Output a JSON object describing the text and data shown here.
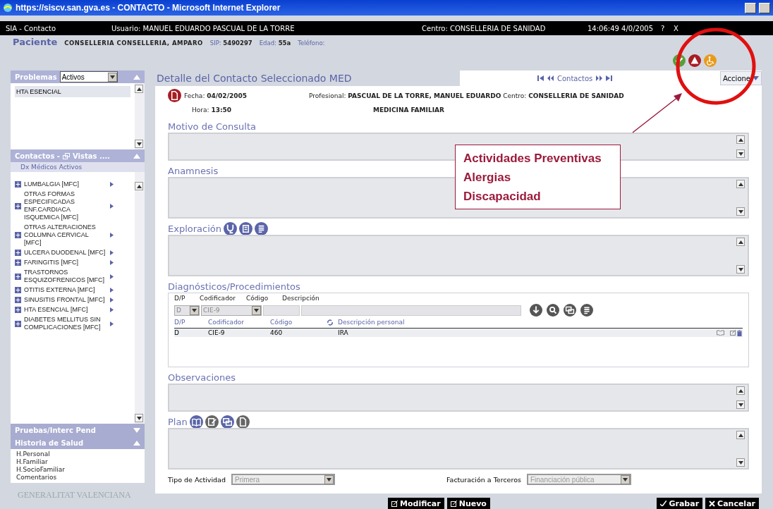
{
  "window": {
    "title": "https://siscv.san.gva.es - CONTACTO - Microsoft Internet Explorer"
  },
  "header": {
    "app": "SIA - Contacto",
    "user": "Usuario: MANUEL EDUARDO PASCUAL DE LA TORRE",
    "centro": "Centro: CONSELLERIA DE SANIDAD",
    "datetime": "14:06:49 4/0/2005",
    "help": "?",
    "close": "X"
  },
  "patient": {
    "label": "Paciente",
    "name": "CONSELLERIA CONSELLERIA, AMPARO",
    "sip_label": "SIP:",
    "sip": "5490297",
    "age_label": "Edad:",
    "age": "55a",
    "phone_label": "Teléfono:"
  },
  "sidebar": {
    "problems": {
      "title": "Problemas",
      "filter": "Activos",
      "expanded": true,
      "items": [
        {
          "label": "HTA ESENCIAL",
          "selected": true
        }
      ]
    },
    "contacts": {
      "title": "Contactos -",
      "views": "Vistas ....",
      "expanded": true,
      "subtitle": "Dx Médicos Activos",
      "items": [
        {
          "label": "LUMBALGIA [MFC]"
        },
        {
          "label": "OTRAS FORMAS ESPECIFICADAS ENF.CARDIACA ISQUEMICA [MFC]"
        },
        {
          "label": "OTRAS ALTERACIONES COLUMNA CERVICAL [MFC]"
        },
        {
          "label": "ULCERA DUODENAL [MFC]"
        },
        {
          "label": "FARINGITIS [MFC]"
        },
        {
          "label": "TRASTORNOS ESQUIZOFRENICOS [MFC]"
        },
        {
          "label": "OTITIS EXTERNA [MFC]"
        },
        {
          "label": "SINUSITIS FRONTAL [MFC]"
        },
        {
          "label": "HTA ESENCIAL [MFC]"
        },
        {
          "label": "DIABETES MELLITUS SIN COMPLICACIONES [MFC]"
        }
      ]
    },
    "pending": {
      "title": "Pruebas/Interc Pend",
      "expanded": false
    },
    "history": {
      "title": "Historia de Salud",
      "expanded": true,
      "items": [
        "H.Personal",
        "H.Familiar",
        "H.SocioFamiliar",
        "Comentarios"
      ]
    },
    "logo": "GENERALITAT VALENCIANA"
  },
  "main": {
    "title": "Detalle del Contacto Seleccionado MED",
    "nav_label": "Contactos",
    "actions": "Accione",
    "info": {
      "date_label": "Fecha:",
      "date": "04/02/2005",
      "time_label": "Hora:",
      "time": "13:50",
      "professional_label": "Profesional:",
      "professional": "PASCUAL DE LA TORRE, MANUEL EDUARDO",
      "centre_label": "Centro:",
      "centre": "CONSELLERIA DE SANIDAD",
      "specialty": "MEDICINA FAMILIAR"
    },
    "sections": [
      {
        "kind": "short",
        "title": "Motivo de Consulta"
      },
      {
        "kind": "long",
        "title": "Anamnesis"
      },
      {
        "kind": "exam",
        "title": "Exploración"
      },
      {
        "kind": "diagnosis",
        "title": "Diagnósticos/Procedimientos"
      },
      {
        "kind": "short",
        "title": "Observaciones"
      },
      {
        "kind": "plan",
        "title": "Plan"
      }
    ],
    "diagnosis": {
      "entry_headers": [
        "D/P",
        "Codificador",
        "Código",
        "Descripción"
      ],
      "entry_dp": "D",
      "entry_coder": "CIE-9",
      "list_headers": [
        "D/P",
        "Codificador",
        "Código",
        "Descripción personal"
      ],
      "rows": [
        [
          "D",
          "CIE-9",
          "460",
          "IRA"
        ]
      ]
    },
    "activity": {
      "label": "Tipo de Actividad",
      "value": "Primera"
    },
    "billing": {
      "label": "Facturación a Terceros",
      "value": "Financiación pública"
    }
  },
  "buttons": [
    {
      "label": "Modificar",
      "kind": "edit"
    },
    {
      "label": "Nuevo",
      "kind": "new"
    },
    {
      "label": "Grabar",
      "kind": "save"
    },
    {
      "label": "Cancelar",
      "kind": "cancel"
    }
  ],
  "annotation": {
    "lines": [
      "Actividades Preventivas",
      "Alergias",
      "Discapacidad"
    ]
  }
}
